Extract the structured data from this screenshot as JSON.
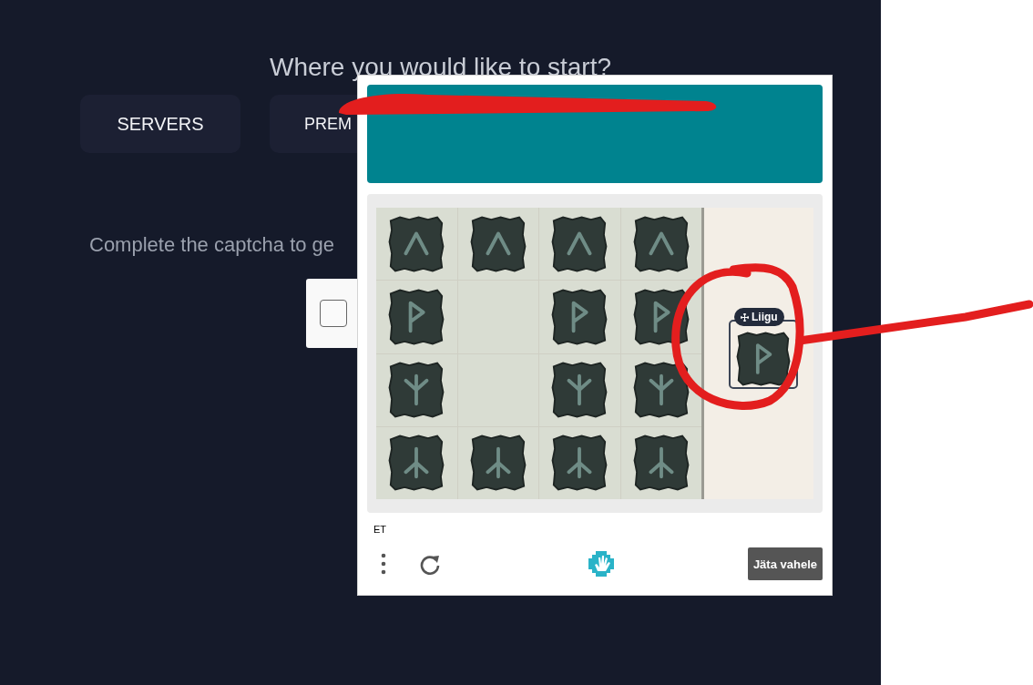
{
  "page": {
    "heading": "Where you would like to start?",
    "buttons": [
      "SERVERS",
      "PREM"
    ],
    "captcha_prompt": "Complete the captcha to ge",
    "checkbox": {
      "checked": false
    }
  },
  "captcha": {
    "tiles": [
      {
        "kind": "caret"
      },
      {
        "kind": "caret"
      },
      {
        "kind": "caret"
      },
      {
        "kind": "caret"
      },
      {
        "kind": "wunjo"
      },
      {
        "kind": "empty"
      },
      {
        "kind": "wunjo"
      },
      {
        "kind": "wunjo"
      },
      {
        "kind": "algiz"
      },
      {
        "kind": "empty"
      },
      {
        "kind": "algiz"
      },
      {
        "kind": "algiz"
      },
      {
        "kind": "inverted-algiz"
      },
      {
        "kind": "inverted-algiz"
      },
      {
        "kind": "inverted-algiz"
      },
      {
        "kind": "inverted-algiz"
      }
    ],
    "dragged_tile": {
      "kind": "wunjo",
      "badge": "Liigu"
    },
    "language": "ET",
    "skip_button": "Jäta vahele"
  }
}
